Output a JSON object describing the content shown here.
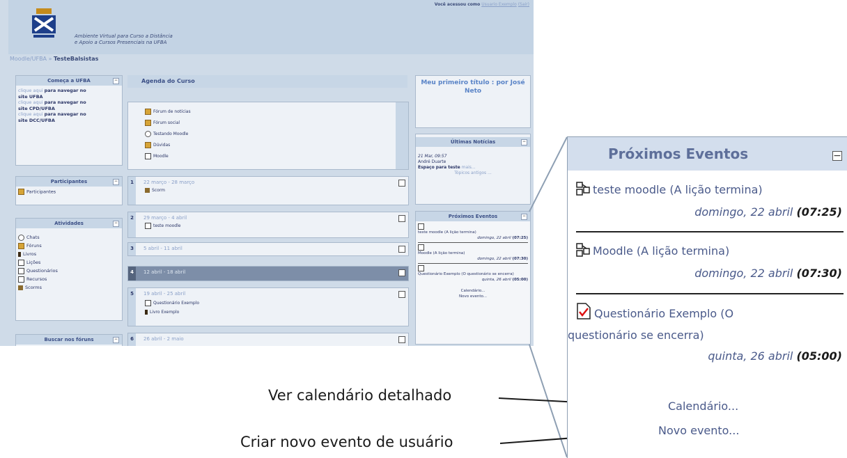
{
  "site": {
    "banner_line1": "Ambiente Virtual para Curso a Distância",
    "banner_line2": "e Apoio a Cursos Presenciais na UFBA",
    "logged_in_prefix": "Você acessou como",
    "logged_in_user": "Usuario Exemplo",
    "logout_link": "(Sair)",
    "breadcrumb_root": "Moodle/UFBA",
    "breadcrumb_sep": "»",
    "breadcrumb_current": "TesteBalsistas"
  },
  "left_blocks": {
    "comece": {
      "title": "Começa a UFBA",
      "items": [
        {
          "link": "clique aqui",
          "text": "para navegar no",
          "text2": "site UFBA"
        },
        {
          "link": "clique aqui",
          "text": "para navegar no",
          "text2": "site CPD/UFBA"
        },
        {
          "link": "clique aqui",
          "text": "para navegar no",
          "text2": "site DCC/UFBA"
        }
      ]
    },
    "participantes": {
      "title": "Participantes",
      "items": [
        "Participantes"
      ]
    },
    "atividades": {
      "title": "Atividades",
      "items": [
        "Chats",
        "Fóruns",
        "Livros",
        "Lições",
        "Questionários",
        "Recursos",
        "Scorms"
      ]
    },
    "buscar": {
      "title": "Buscar nos fóruns"
    }
  },
  "center": {
    "title": "Agenda do Curso",
    "intro_items": [
      "Fórum de notícias",
      "Fórum social",
      "Testando Moodle",
      "Dúvidas",
      "Moodle"
    ],
    "weeks": [
      {
        "num": "1",
        "title": "22 março - 28 março",
        "items": [
          "Scorm"
        ]
      },
      {
        "num": "2",
        "title": "29 março - 4 abril",
        "items": [
          "teste moodle"
        ]
      },
      {
        "num": "3",
        "title": "5 abril - 11 abril",
        "items": []
      },
      {
        "num": "4",
        "title": "12 abril - 18 abril",
        "items": []
      },
      {
        "num": "5",
        "title": "19 abril - 25 abril",
        "items": [
          "Questionário Exemplo",
          "Livro Exemplo"
        ]
      },
      {
        "num": "6",
        "title": "26 abril - 2 maio",
        "items": []
      }
    ]
  },
  "right_blocks": {
    "first_title": "Meu primeiro título : por José Neto",
    "news": {
      "title": "Últimas Notícias",
      "date": "21 Mar, 09:57",
      "author": "André Duarte",
      "text": "Espaço para teste",
      "more": "mais...",
      "older": "Tópicos antigos ..."
    }
  },
  "events_small": {
    "title": "Próximos Eventos",
    "events": [
      {
        "name": "teste moodle (A lição termina)",
        "date": "domingo, 22 abril",
        "time": "(07:25)"
      },
      {
        "name": "Moodle (A lição termina)",
        "date": "domingo, 22 abril",
        "time": "(07:30)"
      },
      {
        "name": "Questionário Exemplo (O questionário se encerra)",
        "date": "quinta, 26 abril",
        "time": "(05:00)"
      }
    ],
    "calendar_link": "Calendário...",
    "new_event_link": "Novo evento..."
  },
  "events_zoom": {
    "title": "Próximos Eventos",
    "collapse": "−",
    "events": [
      {
        "name": "teste moodle (A lição termina)",
        "date": "domingo, 22 abril",
        "time": "(07:25)"
      },
      {
        "name": "Moodle (A lição termina)",
        "date": "domingo, 22 abril",
        "time": "(07:30)"
      },
      {
        "name1": "Questionário Exemplo (O",
        "name2": "questionário se encerra)",
        "date": "quinta, 26 abril",
        "time": "(05:00)"
      }
    ],
    "calendar_link": "Calendário...",
    "new_event_link": "Novo evento..."
  },
  "annotations": {
    "calendar": "Ver calendário detalhado",
    "new_event": "Criar novo evento de usuário"
  },
  "colors": {
    "header_bg": "#c7d6e6",
    "link": "#4a5a8a",
    "muted_link": "#8aa0c8"
  }
}
